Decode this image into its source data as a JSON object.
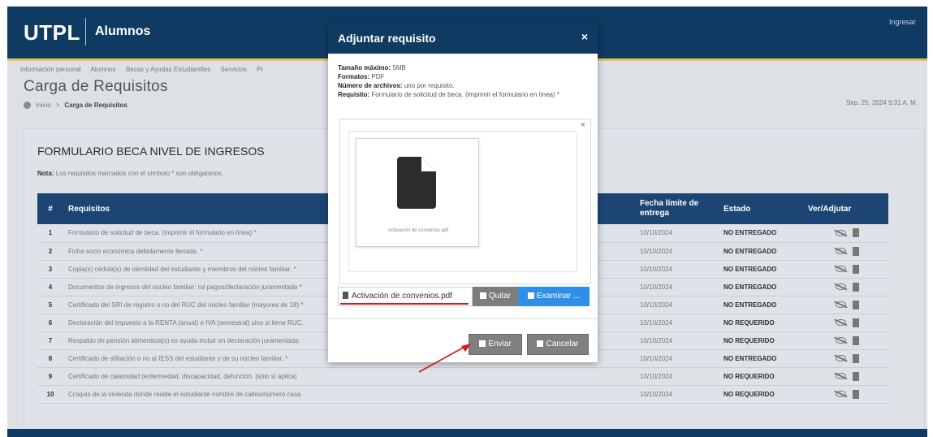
{
  "header": {
    "logo": "UTPL",
    "app": "Alumnos",
    "login": "Ingresar"
  },
  "nav": {
    "items": [
      "Información personal",
      "Alumnos",
      "Becas y Ayudas Estudiantiles",
      "Servicios",
      "Pr"
    ]
  },
  "page": {
    "title": "Carga de Requisitos",
    "breadcrumb_home": "Inicio",
    "breadcrumb_current": "Carga de Requisitos",
    "datestamp": "Sep. 25, 2024 9:31 A. M."
  },
  "form": {
    "title": "FORMULARIO BECA NIVEL DE INGRESOS",
    "note_label": "Nota:",
    "note_text": "Los requisitos marcados con el símbolo * son obligatorios.",
    "columns": {
      "num": "#",
      "req": "Requisitos",
      "fecha": "Fecha límite de entrega",
      "estado": "Estado",
      "ver": "Ver/Adjutar"
    },
    "rows": [
      {
        "num": "1",
        "req": "Formulario de solicitud de beca. (imprimir el formulario en línea) *",
        "fecha": "10/10/2024",
        "estado": "NO ENTREGADO"
      },
      {
        "num": "2",
        "req": "Ficha socio económica debidamente llenada. *",
        "fecha": "10/10/2024",
        "estado": "NO ENTREGADO"
      },
      {
        "num": "3",
        "req": "Copia(s) cédula(s) de identidad del estudiante y miembros del núcleo familiar. *",
        "fecha": "10/10/2024",
        "estado": "NO ENTREGADO"
      },
      {
        "num": "4",
        "req": "Documentos de ingresos del núcleo familiar: rol pagos/declaración juramentada *",
        "fecha": "10/10/2024",
        "estado": "NO ENTREGADO"
      },
      {
        "num": "5",
        "req": "Certificado del SRI de registro o no del RUC del núcleo familiar (mayores de 18) *",
        "fecha": "10/10/2024",
        "estado": "NO ENTREGADO"
      },
      {
        "num": "6",
        "req": "Declaración del impuesto a la RENTA (anual) e IVA (semestral) sino si tiene RUC.",
        "fecha": "10/10/2024",
        "estado": "NO REQUERIDO"
      },
      {
        "num": "7",
        "req": "Respaldo de pensión alimenticia(s) es ayuda incluir en declaración juramentada.",
        "fecha": "10/10/2024",
        "estado": "NO REQUERIDO"
      },
      {
        "num": "8",
        "req": "Certificado de afiliación o no al IESS del estudiante y de su núcleo familiar. *",
        "fecha": "10/10/2024",
        "estado": "NO ENTREGADO"
      },
      {
        "num": "9",
        "req": "Certificado de calamidad (enfermedad, discapacidad, defunción. (sólo si aplica)",
        "fecha": "10/10/2024",
        "estado": "NO REQUERIDO"
      },
      {
        "num": "10",
        "req": "Croquis de la vivienda donde reside el estudiante nombre de calles/número casa",
        "fecha": "10/10/2024",
        "estado": "NO REQUERIDO"
      }
    ]
  },
  "modal": {
    "title": "Adjuntar requisito",
    "close": "×",
    "size_label": "Tamaño máximo:",
    "size_value": "5MB",
    "format_label": "Formatos:",
    "format_value": "PDF",
    "count_label": "Número de archivos:",
    "count_value": "uno por requisito.",
    "req_label": "Requisito:",
    "req_value": "Formulario de solicitud de beca. (imprimir el formulario en línea) *",
    "dropzone_close": "×",
    "thumb_caption": "Activación de convenios.pdf",
    "filename": "Activación de convenios.pdf",
    "quitar": "Quitar",
    "examinar": "Examinar ...",
    "enviar": "Enviar",
    "cancelar": "Cancelar"
  },
  "icons": [
    "file-icon",
    "eye-slash-icon",
    "home-icon",
    "trash-icon",
    "folder-icon",
    "upload-icon",
    "close-icon"
  ],
  "colors": {
    "primary": "#0f3a62",
    "accent": "#2f8fe8",
    "table_header": "#1c4573",
    "highlight_red": "#d11b1b",
    "gold": "#e5c063"
  }
}
